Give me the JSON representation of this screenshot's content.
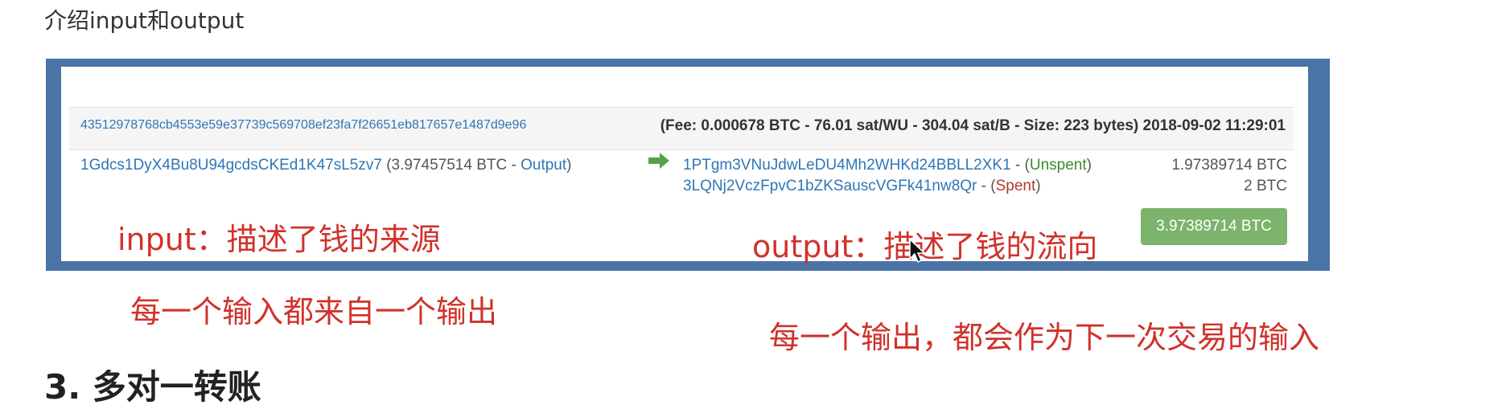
{
  "doc": {
    "intro_text": "介绍input和output",
    "next_heading": "3. 多对一转账"
  },
  "tx": {
    "hash": "43512978768cb4553e59e37739c569708ef23fa7f26651eb817657e1487d9e96",
    "meta": "(Fee: 0.000678 BTC - 76.01 sat/WU - 304.04 sat/B - Size: 223 bytes) 2018-09-02 11:29:01",
    "input": {
      "address": "1Gdcs1DyX4Bu8U94gcdsCKEd1K47sL5zv7",
      "amount_text": "(3.97457514 BTC - ",
      "type_label": "Output",
      "close": ")"
    },
    "outputs": [
      {
        "address": "1PTgm3VNuJdwLeDU4Mh2WHKd24BBLL2XK1",
        "sep": " - (",
        "status": "Unspent",
        "close": ")",
        "amount": "1.97389714 BTC"
      },
      {
        "address": "3LQNj2VczFpvC1bZKS",
        "address_tail": "auscVGFk41nw8Qr",
        "sep": " - (",
        "status": "Spent",
        "close": ")",
        "amount": "2 BTC"
      }
    ],
    "total": "3.97389714 BTC"
  },
  "annotations": {
    "input_desc": "input：描述了钱的来源",
    "output_desc": "output：描述了钱的流向",
    "each_input": "每一个输入都来自一个输出",
    "each_output": "每一个输出，都会作为下一次交易的输入"
  },
  "colors": {
    "frame": "#4a73a6",
    "link": "#2f76b5",
    "annotation": "#d0322b",
    "total_button": "#7cb36d",
    "unspent": "#3c8a2e",
    "spent": "#b23a2e"
  },
  "icons": {
    "arrow": "right-arrow-icon",
    "cursor": "mouse-pointer-icon"
  }
}
